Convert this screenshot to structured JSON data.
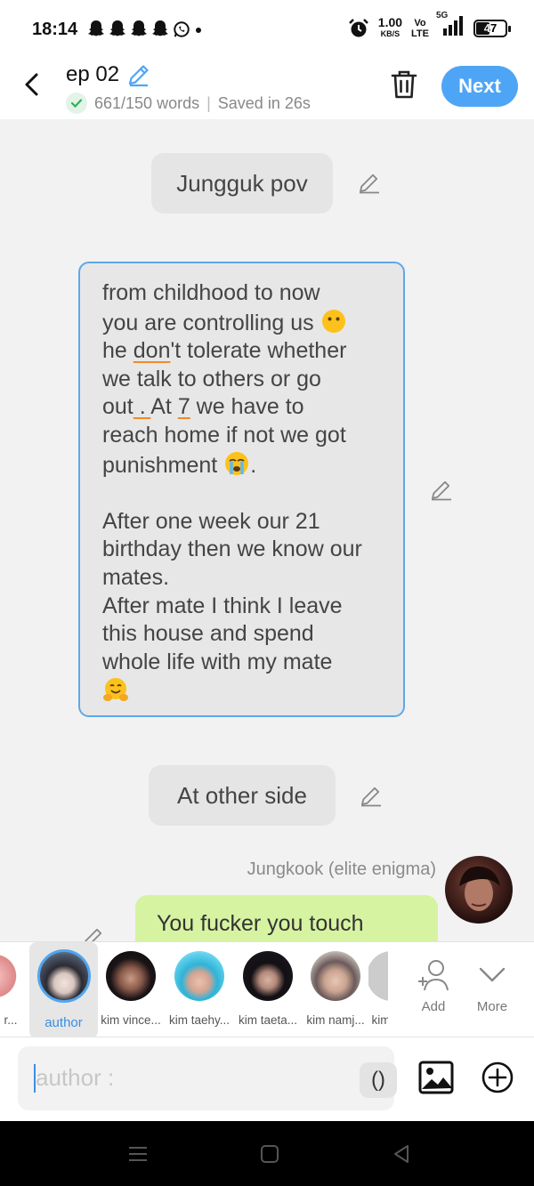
{
  "status_bar": {
    "time": "18:14",
    "network_speed": "1.00",
    "network_speed_unit": "KB/S",
    "volte_top": "Vo",
    "volte_bottom": "LTE",
    "network_type": "5G",
    "battery_level": "47",
    "icons": [
      "snapchat-icon",
      "snapchat-icon",
      "snapchat-icon",
      "snapchat-icon",
      "whatsapp-icon",
      "dot-icon",
      "alarm-icon",
      "signal-icon",
      "battery-icon"
    ]
  },
  "header": {
    "title": "ep 02",
    "word_count": "661/150 words",
    "saved_status": "Saved in 26s",
    "next_label": "Next",
    "accent_color": "#4ea5f6"
  },
  "chat": {
    "narration_1": "Jungguk pov",
    "big_message": {
      "line_1": "from childhood to now",
      "line_2": "you are controlling us",
      "line_3_a": "he ",
      "line_3_b": "don",
      "line_3_c": "'t tolerate whether",
      "line_4": "we talk to others or go",
      "line_5_a": "out",
      "line_5_b": " . ",
      "line_5_c": "At ",
      "line_5_d": "7",
      "line_5_e": " we have to",
      "line_6": "reach home if not we got",
      "line_7": "punishment",
      "line_7_end": ".",
      "line_9": "After one week our 21",
      "line_10": "birthday then we know our",
      "line_11": "mates.",
      "line_12": "After mate I think I leave",
      "line_13": "this house and spend",
      "line_14": "whole life with my mate"
    },
    "narration_2": "At other side",
    "speaker_name": "Jungkook (elite enigma)",
    "green_message": "You fucker you touch"
  },
  "characters": {
    "partial_left": "r...",
    "items": [
      {
        "name": "author",
        "selected": true
      },
      {
        "name": "kim vince..."
      },
      {
        "name": "kim taehy..."
      },
      {
        "name": "kim taeta..."
      },
      {
        "name": "kim namj..."
      },
      {
        "name": "kim"
      }
    ],
    "add_label": "Add",
    "more_label": "More"
  },
  "input": {
    "placeholder": "author :",
    "paren_label": "()"
  }
}
